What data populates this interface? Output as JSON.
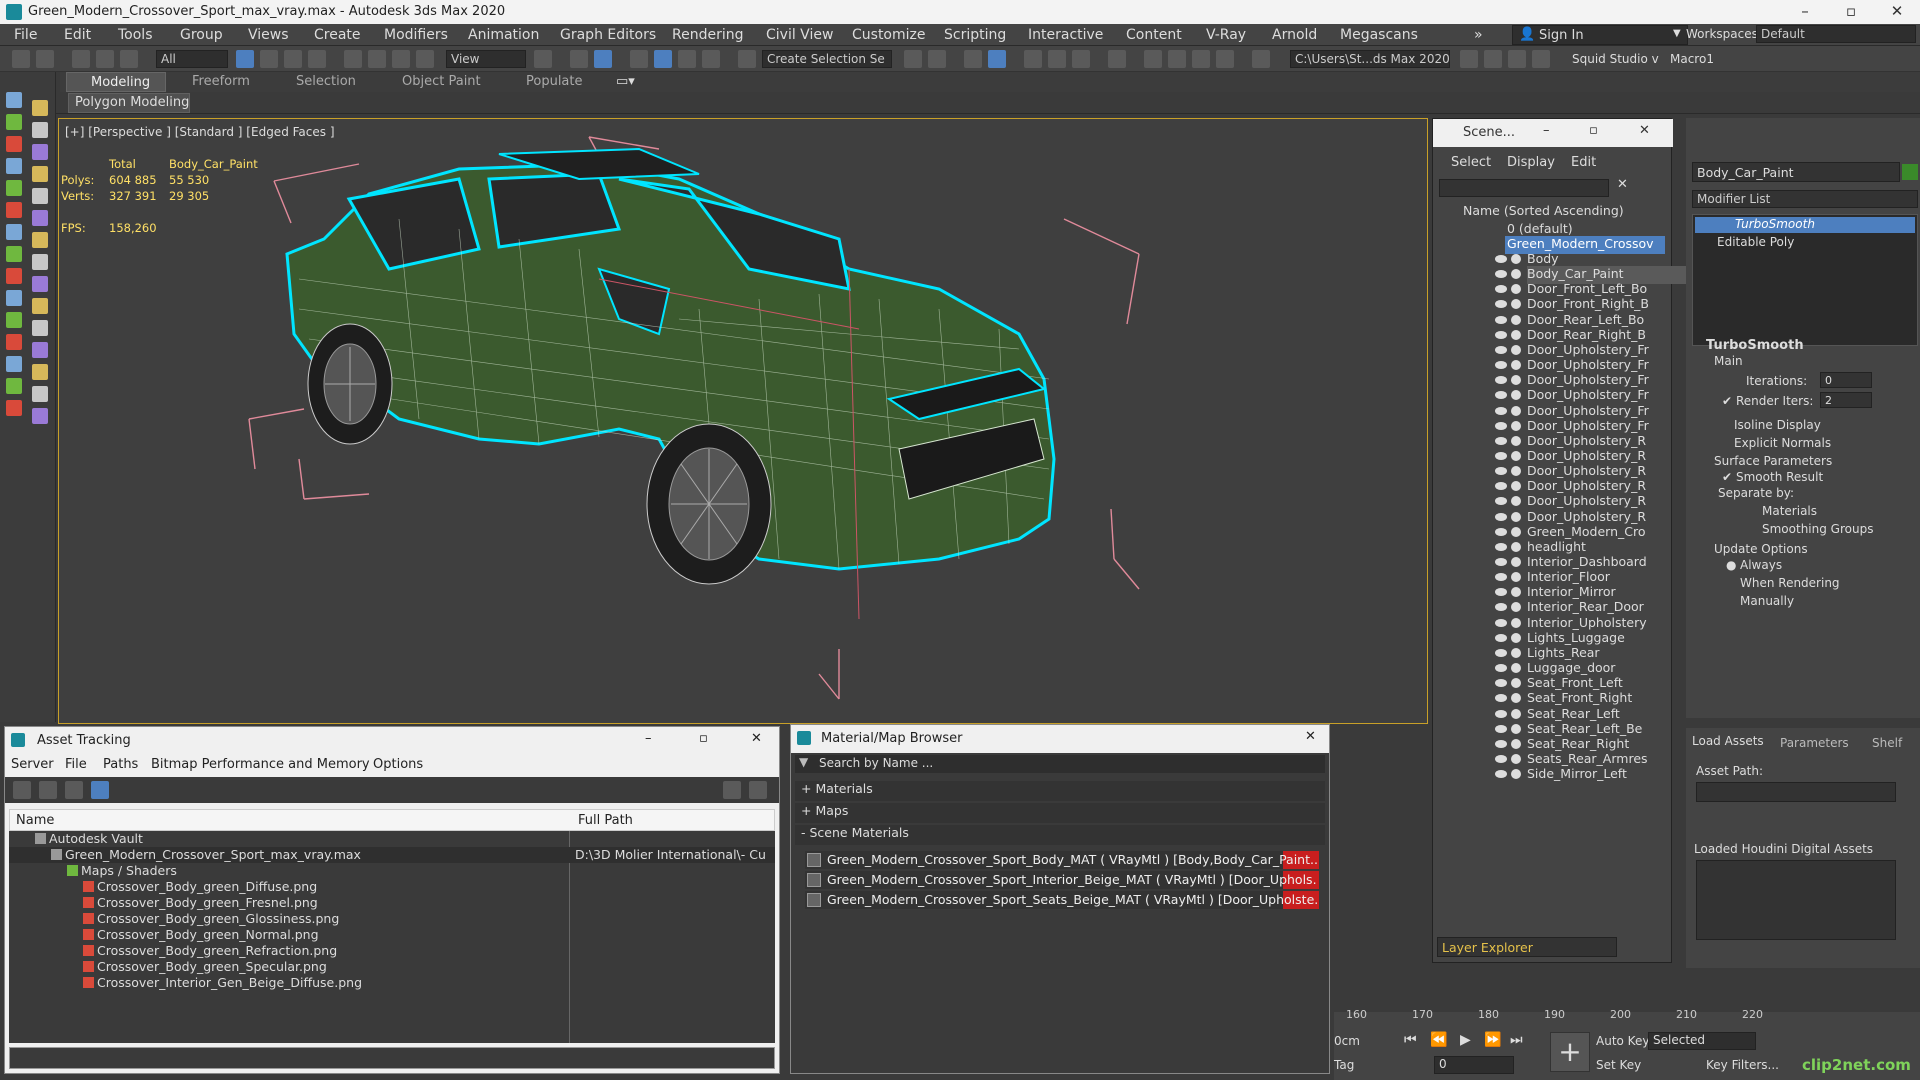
{
  "window": {
    "title": "Green_Modern_Crossover_Sport_max_vray.max - Autodesk 3ds Max 2020"
  },
  "menu": [
    "File",
    "Edit",
    "Tools",
    "Group",
    "Views",
    "Create",
    "Modifiers",
    "Animation",
    "Graph Editors",
    "Rendering",
    "Civil View",
    "Customize",
    "Scripting",
    "Interactive",
    "Content",
    "V-Ray",
    "Arnold",
    "Megascans"
  ],
  "signin": "Sign In",
  "workspaces": {
    "label": "Workspaces:",
    "value": "Default"
  },
  "toolbar": {
    "filter": "All",
    "view": "View",
    "selection_set": "Create Selection Se",
    "path": "C:\\Users\\St...ds Max 2020",
    "project": "Squid Studio v",
    "macro": "Macro1"
  },
  "ribbon": {
    "tabs": [
      "Modeling",
      "Freeform",
      "Selection",
      "Object Paint",
      "Populate"
    ],
    "sub": "Polygon Modeling"
  },
  "viewport": {
    "label": "[+] [Perspective ] [Standard ] [Edged Faces ]",
    "stats": {
      "col_total": "Total",
      "col_obj": "Body_Car_Paint",
      "polys_label": "Polys:",
      "polys_total": "604 885",
      "polys_obj": "55 530",
      "verts_label": "Verts:",
      "verts_total": "327 391",
      "verts_obj": "29 305",
      "fps_label": "FPS:",
      "fps_value": "158,260"
    }
  },
  "scene_explorer": {
    "title": "Scene...",
    "menu": [
      "Select",
      "Display",
      "Edit"
    ],
    "column": "Name (Sorted Ascending)",
    "layer": "0 (default)",
    "root": "Green_Modern_Crossov",
    "items": [
      "Body",
      "Body_Car_Paint",
      "Door_Front_Left_Bo",
      "Door_Front_Right_B",
      "Door_Rear_Left_Bo",
      "Door_Rear_Right_B",
      "Door_Upholstery_Fr",
      "Door_Upholstery_Fr",
      "Door_Upholstery_Fr",
      "Door_Upholstery_Fr",
      "Door_Upholstery_Fr",
      "Door_Upholstery_Fr",
      "Door_Upholstery_R",
      "Door_Upholstery_R",
      "Door_Upholstery_R",
      "Door_Upholstery_R",
      "Door_Upholstery_R",
      "Door_Upholstery_R",
      "Green_Modern_Cro",
      "headlight",
      "Interior_Dashboard",
      "Interior_Floor",
      "Interior_Mirror",
      "Interior_Rear_Door",
      "Interior_Upholstery",
      "Lights_Luggage",
      "Lights_Rear",
      "Luggage_door",
      "Seat_Front_Left",
      "Seat_Front_Right",
      "Seat_Rear_Left",
      "Seat_Rear_Left_Be",
      "Seat_Rear_Right",
      "Seats_Rear_Armres",
      "Side_Mirror_Left"
    ],
    "footer": "Layer Explorer"
  },
  "command_panel": {
    "object_name": "Body_Car_Paint",
    "modifier_list": "Modifier List",
    "stack": [
      "TurboSmooth",
      "Editable Poly"
    ],
    "rollout": "TurboSmooth",
    "main": "Main",
    "iterations_label": "Iterations:",
    "iterations": "0",
    "render_iters_label": "Render Iters:",
    "render_iters": "2",
    "isoline": "Isoline Display",
    "explicit": "Explicit Normals",
    "surface": "Surface Parameters",
    "smooth_result": "Smooth Result",
    "separate_by": "Separate by:",
    "materials": "Materials",
    "smoothing": "Smoothing Groups",
    "update": "Update Options",
    "always": "Always",
    "when_rendering": "When Rendering",
    "manually": "Manually"
  },
  "houdini": {
    "tabs": [
      "Load Assets",
      "Parameters",
      "Shelf"
    ],
    "asset_path": "Asset Path:",
    "loaded": "Loaded Houdini Digital Assets"
  },
  "asset_tracking": {
    "title": "Asset Tracking",
    "menu": [
      "Server",
      "File",
      "Paths",
      "Bitmap Performance and Memory",
      "Options"
    ],
    "col_name": "Name",
    "col_path": "Full Path",
    "rows": [
      {
        "name": "Autodesk Vault",
        "path": "",
        "indent": 0
      },
      {
        "name": "Green_Modern_Crossover_Sport_max_vray.max",
        "path": "D:\\3D Molier International\\- Cu",
        "indent": 1
      },
      {
        "name": "Maps / Shaders",
        "path": "",
        "indent": 2
      },
      {
        "name": "Crossover_Body_green_Diffuse.png",
        "path": "",
        "indent": 3
      },
      {
        "name": "Crossover_Body_green_Fresnel.png",
        "path": "",
        "indent": 3
      },
      {
        "name": "Crossover_Body_green_Glossiness.png",
        "path": "",
        "indent": 3
      },
      {
        "name": "Crossover_Body_green_Normal.png",
        "path": "",
        "indent": 3
      },
      {
        "name": "Crossover_Body_green_Refraction.png",
        "path": "",
        "indent": 3
      },
      {
        "name": "Crossover_Body_green_Specular.png",
        "path": "",
        "indent": 3
      },
      {
        "name": "Crossover_Interior_Gen_Beige_Diffuse.png",
        "path": "",
        "indent": 3
      }
    ]
  },
  "material_browser": {
    "title": "Material/Map Browser",
    "search": "Search by Name ...",
    "groups": [
      "+ Materials",
      "+ Maps",
      "- Scene Materials"
    ],
    "materials": [
      "Green_Modern_Crossover_Sport_Body_MAT ( VRayMtl ) [Body,Body_Car_Paint...",
      "Green_Modern_Crossover_Sport_Interior_Beige_MAT ( VRayMtl ) [Door_Uphols...",
      "Green_Modern_Crossover_Sport_Seats_Beige_MAT ( VRayMtl ) [Door_Upholste..."
    ]
  },
  "timeline": {
    "ticks": [
      "160",
      "170",
      "180",
      "190",
      "200",
      "210",
      "220"
    ],
    "unit": "0cm",
    "tag": "Tag",
    "autokey": "Auto Key",
    "setkey": "Set Key",
    "selected": "Selected",
    "keyfilters": "Key Filters...",
    "frame": "0",
    "watermark": "clip2net.com"
  },
  "colors": {
    "accent": "#4d7fbf",
    "wire": "#00e5ff",
    "body": "#3b5a2e"
  }
}
